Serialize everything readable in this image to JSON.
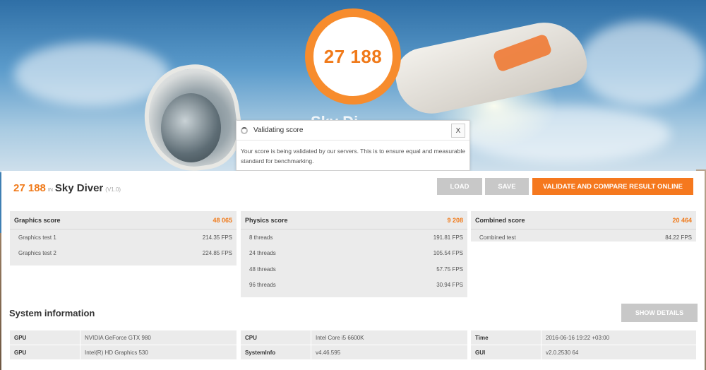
{
  "badge": {
    "score": "27 188"
  },
  "background_title": "Sky Di",
  "dialog": {
    "title": "Validating score",
    "close": "X",
    "body": "Your score is being validated by our servers. This is to ensure equal and measurable standard for benchmarking."
  },
  "result": {
    "score": "27 188",
    "in": "IN",
    "name": "Sky Diver",
    "version": "(V1.0)"
  },
  "buttons": {
    "load": "LOAD",
    "save": "SAVE",
    "validate": "VALIDATE AND COMPARE RESULT ONLINE",
    "show_details": "SHOW DETAILS"
  },
  "scores": {
    "graphics": {
      "title": "Graphics score",
      "value": "48 065",
      "rows": [
        {
          "label": "Graphics test 1",
          "value": "214.35 FPS"
        },
        {
          "label": "Graphics test 2",
          "value": "224.85 FPS"
        }
      ]
    },
    "physics": {
      "title": "Physics score",
      "value": "9 208",
      "rows": [
        {
          "label": "8 threads",
          "value": "191.81 FPS"
        },
        {
          "label": "24 threads",
          "value": "105.54 FPS"
        },
        {
          "label": "48 threads",
          "value": "57.75 FPS"
        },
        {
          "label": "96 threads",
          "value": "30.94 FPS"
        }
      ]
    },
    "combined": {
      "title": "Combined score",
      "value": "20 464",
      "rows": [
        {
          "label": "Combined test",
          "value": "84.22 FPS"
        }
      ]
    }
  },
  "system": {
    "title": "System information",
    "col1": [
      {
        "key": "GPU",
        "value": "NVIDIA GeForce GTX 980"
      },
      {
        "key": "GPU",
        "value": "Intel(R) HD Graphics 530"
      }
    ],
    "col2": [
      {
        "key": "CPU",
        "value": "Intel Core i5 6600K"
      },
      {
        "key": "SystemInfo",
        "value": "v4.46.595"
      }
    ],
    "col3": [
      {
        "key": "Time",
        "value": "2016-06-16 19:22 +03:00"
      },
      {
        "key": "GUI",
        "value": "v2.0.2530 64"
      }
    ]
  },
  "colors": {
    "accent": "#f5781e",
    "disabled": "#c8c8c8"
  }
}
